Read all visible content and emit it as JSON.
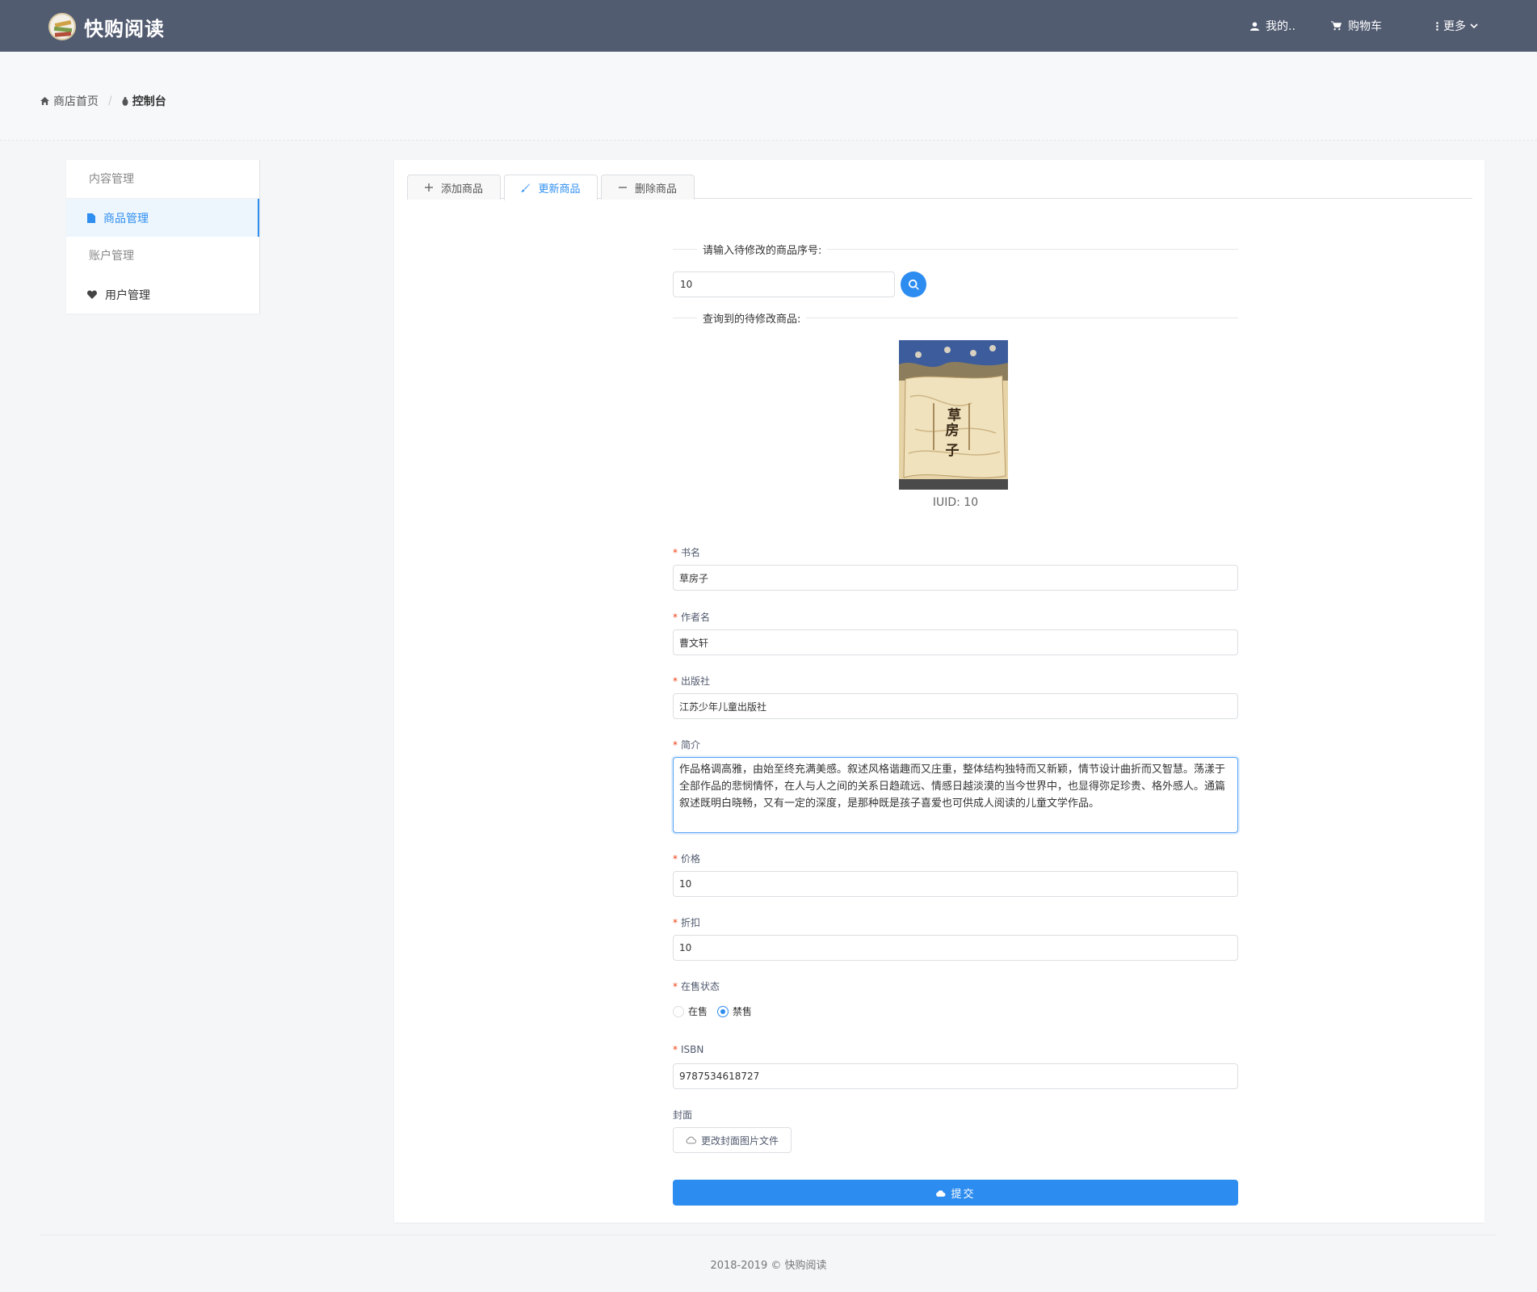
{
  "header": {
    "brand": "快购阅读",
    "nav": {
      "me": "我的..",
      "cart": "购物车",
      "more": "更多"
    }
  },
  "breadcrumb": {
    "home": "商店首页",
    "current": "控制台"
  },
  "sidebar": {
    "section1": "内容管理",
    "items": [
      {
        "label": "商品管理",
        "icon": "file-icon",
        "active": true
      },
      {
        "label": "用户管理",
        "icon": "heart-icon",
        "active": false
      }
    ],
    "section2": "账户管理"
  },
  "tabs": [
    {
      "label": "添加商品",
      "icon": "plus-icon"
    },
    {
      "label": "更新商品",
      "icon": "brush-icon",
      "active": true
    },
    {
      "label": "删除商品",
      "icon": "minus-icon"
    }
  ],
  "form": {
    "search_divider": "请输入待修改的商品序号:",
    "search_value": "10",
    "result_divider": "查询到的待修改商品:",
    "cover_title": "草房子",
    "iuid": "IUID: 10",
    "fields": {
      "title": {
        "label": "书名",
        "value": "草房子"
      },
      "author": {
        "label": "作者名",
        "value": "曹文轩"
      },
      "publisher": {
        "label": "出版社",
        "value": "江苏少年儿童出版社"
      },
      "intro": {
        "label": "简介",
        "value": "作品格调高雅，由始至终充满美感。叙述风格谐趣而又庄重，整体结构独特而又新颖，情节设计曲折而又智慧。荡漾于全部作品的悲悯情怀，在人与人之间的关系日趋疏远、情感日越淡漠的当今世界中，也显得弥足珍贵、格外感人。通篇叙述既明白晓畅，又有一定的深度，是那种既是孩子喜爱也可供成人阅读的儿童文学作品。"
      },
      "price": {
        "label": "价格",
        "value": "10"
      },
      "discount": {
        "label": "折扣",
        "value": "10"
      },
      "status": {
        "label": "在售状态",
        "options": [
          "在售",
          "禁售"
        ],
        "selected": "禁售"
      },
      "isbn": {
        "label": "ISBN",
        "value": "9787534618727"
      },
      "cover": {
        "label": "封面",
        "button": "更改封面图片文件"
      }
    },
    "submit": "提交"
  },
  "footer": "2018-2019 © 快购阅读",
  "colors": {
    "header_bg": "#525c71",
    "primary": "#2d8cf0",
    "required": "#ed4014"
  }
}
